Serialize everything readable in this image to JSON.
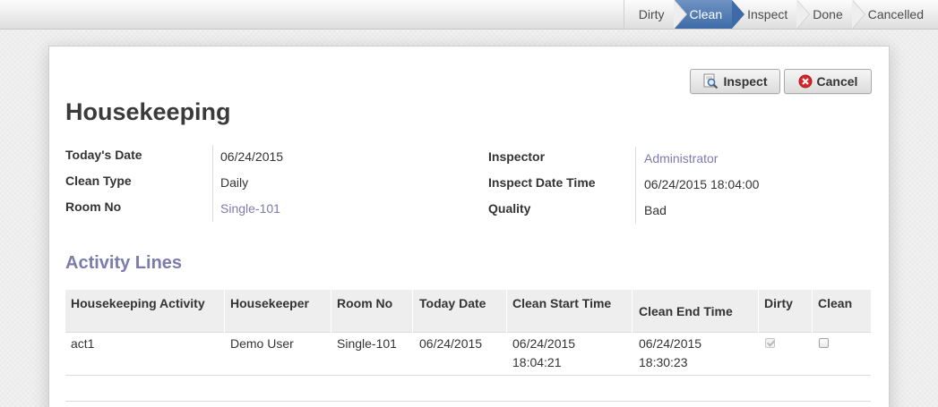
{
  "statusbar": {
    "stages": [
      {
        "label": "Dirty",
        "active": false
      },
      {
        "label": "Clean",
        "active": true
      },
      {
        "label": "Inspect",
        "active": false
      },
      {
        "label": "Done",
        "active": false
      },
      {
        "label": "Cancelled",
        "active": false
      }
    ]
  },
  "actions": {
    "inspect_label": "Inspect",
    "cancel_label": "Cancel"
  },
  "form": {
    "title": "Housekeeping",
    "left_fields": [
      {
        "label": "Today's Date",
        "value": "06/24/2015"
      },
      {
        "label": "Clean Type",
        "value": "Daily"
      },
      {
        "label": "Room No",
        "value": "Single-101"
      }
    ],
    "right_fields": [
      {
        "label": "Inspector",
        "value": "Administrator"
      },
      {
        "label": "Inspect Date Time",
        "value": "06/24/2015 18:04:00"
      },
      {
        "label": "Quality",
        "value": "Bad"
      }
    ]
  },
  "activity": {
    "section_title": "Activity Lines",
    "columns": [
      "Housekeeping Activity",
      "Housekeeper",
      "Room No",
      "Today Date",
      "Clean Start Time",
      "Clean End Time",
      "Dirty",
      "Clean"
    ],
    "rows": [
      {
        "activity": "act1",
        "housekeeper": "Demo User",
        "room_no": "Single-101",
        "today_date": "06/24/2015",
        "clean_start_date": "06/24/2015",
        "clean_start_time": "18:04:21",
        "clean_end_date": "06/24/2015",
        "clean_end_time": "18:30:23",
        "dirty": true,
        "clean": false
      }
    ]
  },
  "colors": {
    "accent": "#7c7bad",
    "active_stage": "#3e6ba8"
  }
}
